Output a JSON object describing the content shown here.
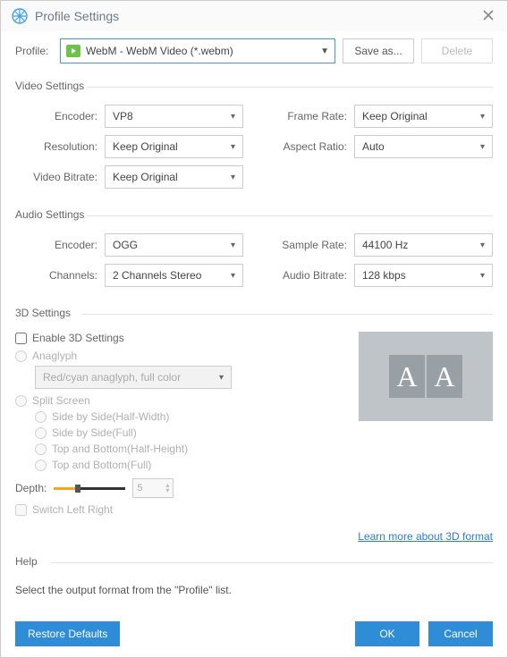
{
  "window": {
    "title": "Profile Settings"
  },
  "topbar": {
    "profile_label": "Profile:",
    "profile_value": "WebM - WebM Video (*.webm)",
    "save_as": "Save as...",
    "delete": "Delete"
  },
  "video": {
    "heading": "Video Settings",
    "encoder_label": "Encoder:",
    "encoder_value": "VP8",
    "resolution_label": "Resolution:",
    "resolution_value": "Keep Original",
    "bitrate_label": "Video Bitrate:",
    "bitrate_value": "Keep Original",
    "framerate_label": "Frame Rate:",
    "framerate_value": "Keep Original",
    "aspect_label": "Aspect Ratio:",
    "aspect_value": "Auto"
  },
  "audio": {
    "heading": "Audio Settings",
    "encoder_label": "Encoder:",
    "encoder_value": "OGG",
    "channels_label": "Channels:",
    "channels_value": "2 Channels Stereo",
    "samplerate_label": "Sample Rate:",
    "samplerate_value": "44100 Hz",
    "bitrate_label": "Audio Bitrate:",
    "bitrate_value": "128 kbps"
  },
  "threed": {
    "heading": "3D Settings",
    "enable": "Enable 3D Settings",
    "anaglyph": "Anaglyph",
    "anaglyph_sel": "Red/cyan anaglyph, full color",
    "split": "Split Screen",
    "sbs_half": "Side by Side(Half-Width)",
    "sbs_full": "Side by Side(Full)",
    "tab_half": "Top and Bottom(Half-Height)",
    "tab_full": "Top and Bottom(Full)",
    "depth_label": "Depth:",
    "depth_value": "5",
    "switch": "Switch Left Right",
    "learn": "Learn more about 3D format",
    "preview_a": "A"
  },
  "help": {
    "heading": "Help",
    "text": "Select the output format from the \"Profile\" list."
  },
  "bottom": {
    "restore": "Restore Defaults",
    "ok": "OK",
    "cancel": "Cancel"
  }
}
